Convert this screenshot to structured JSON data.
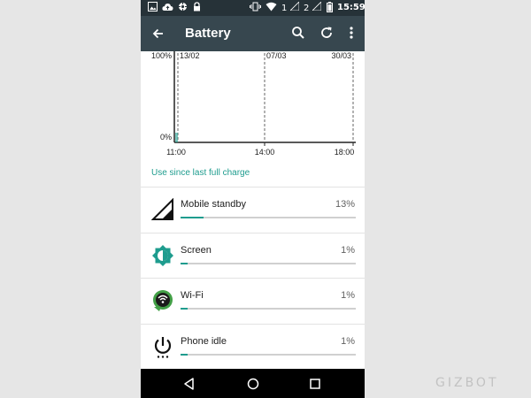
{
  "status_bar": {
    "time": "15:59",
    "sim1": "1",
    "sim2": "2",
    "icons": [
      "image-icon",
      "cloud-upload-icon",
      "settings-icon",
      "lock-icon",
      "vibrate-icon",
      "wifi-icon",
      "signal-icon",
      "signal-icon",
      "battery-icon"
    ]
  },
  "app_bar": {
    "title": "Battery",
    "icons": [
      "back-arrow-icon",
      "search-icon",
      "refresh-icon",
      "more-vert-icon"
    ]
  },
  "chart_data": {
    "type": "area",
    "y_labels": [
      "100%",
      "0%"
    ],
    "ylim": [
      0,
      100
    ],
    "x_ticks": [
      "11:00",
      "14:00",
      "18:00"
    ],
    "date_markers": [
      "13/02",
      "07/03",
      "30/03"
    ],
    "accent": "#1e9c8e"
  },
  "usage_link": "Use since last full charge",
  "items": [
    {
      "name": "Mobile standby",
      "percent_label": "13%",
      "fraction": 0.13,
      "icon": "signal-icon"
    },
    {
      "name": "Screen",
      "percent_label": "1%",
      "fraction": 0.01,
      "icon": "brightness-icon"
    },
    {
      "name": "Wi-Fi",
      "percent_label": "1%",
      "fraction": 0.01,
      "icon": "wifi-icon"
    },
    {
      "name": "Phone idle",
      "percent_label": "1%",
      "fraction": 0.01,
      "icon": "power-icon"
    }
  ],
  "navigation": {
    "icons": [
      "back-icon",
      "home-icon",
      "recents-icon"
    ]
  },
  "watermark": "GIZBOT",
  "colors": {
    "accent": "#1e9c8e",
    "app_bar": "#37474f",
    "status_bar": "#263238"
  }
}
